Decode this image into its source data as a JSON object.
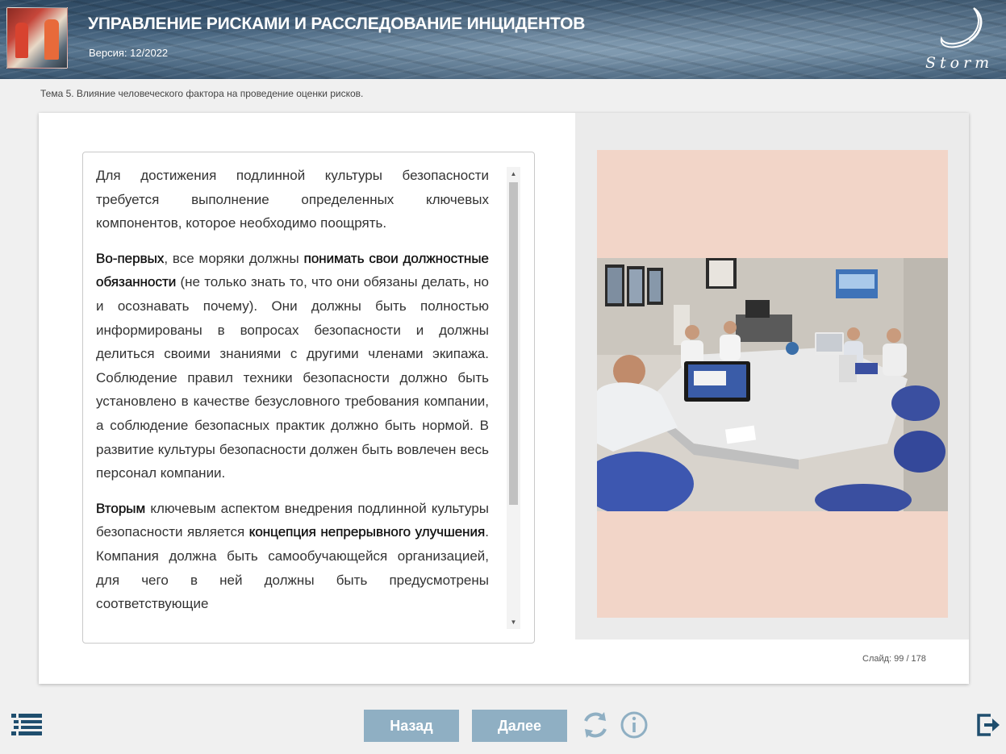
{
  "header": {
    "title": "УПРАВЛЕНИЕ РИСКАМИ И РАССЛЕДОВАНИЕ ИНЦИДЕНТОВ",
    "version": "Версия: 12/2022",
    "logo_text": "Storm"
  },
  "topic": "Тема 5. Влияние человеческого фактора на проведение оценки рисков.",
  "content": {
    "p1": "Для достижения подлинной культуры безопасности требуется выполнение определенных ключевых компонентов, которое необходимо поощрять.",
    "p2_b1": "Во-первых",
    "p2_t1": ", все моряки должны ",
    "p2_b2": "понимать свои должностные обязанности",
    "p2_t2": " (не только знать то, что они обязаны делать, но и осознавать почему). Они должны быть полностью информированы в вопросах безопасности и должны делиться своими знаниями с другими членами экипажа. Соблюдение правил техники безопасности должно быть установлено в качестве безусловного требования компании, а соблюдение безопасных практик должно быть нормой. В развитие культуры безопасности должен быть вовлечен весь персонал компании.",
    "p3_b1": "Вторым",
    "p3_t1": " ключевым аспектом внедрения подлинной культуры безопасности является ",
    "p3_b2": "концепция непрерывного улучшения",
    "p3_t2": ". Компания должна быть самообучающейся организацией, для чего в ней должны быть предусмотрены соответствующие"
  },
  "slide": {
    "label": "Слайд:",
    "current": "99",
    "separator": "/",
    "total": "178",
    "text": "Слайд:  99 / 178"
  },
  "nav": {
    "back": "Назад",
    "next": "Далее"
  },
  "colors": {
    "button_bg": "#8fafc3",
    "icon": "#8fafc3",
    "dark_icon": "#1f4e6e",
    "panel_bg": "#f2d5c8"
  }
}
